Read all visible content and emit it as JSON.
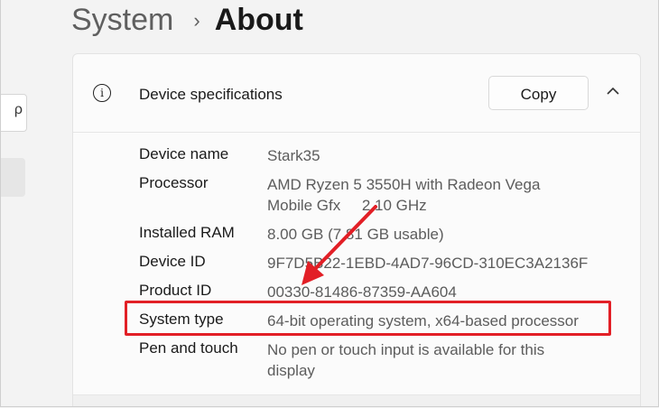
{
  "breadcrumb": {
    "parent": "System",
    "separator": "›",
    "current": "About"
  },
  "sidebar": {
    "search_glyph": "ρ"
  },
  "card": {
    "icon": "info-icon",
    "info_glyph": "i",
    "title": "Device specifications",
    "copy_label": "Copy",
    "collapse_icon": "chevron-up-icon"
  },
  "specs": [
    {
      "label": "Device name",
      "value": "Stark35"
    },
    {
      "label": "Processor",
      "value": "AMD Ryzen 5 3550H with Radeon Vega Mobile Gfx     2.10 GHz"
    },
    {
      "label": "Installed RAM",
      "value": "8.00 GB (7.81 GB usable)"
    },
    {
      "label": "Device ID",
      "value": "9F7D5B22-1EBD-4AD7-96CD-310EC3A2136F"
    },
    {
      "label": "Product ID",
      "value": "00330-81486-87359-AA604"
    },
    {
      "label": "System type",
      "value": "64-bit operating system, x64-based processor"
    },
    {
      "label": "Pen and touch",
      "value": "No pen or touch input is available for this display"
    }
  ],
  "annotation": {
    "color": "#e21f26",
    "highlighted_row": "System type"
  }
}
